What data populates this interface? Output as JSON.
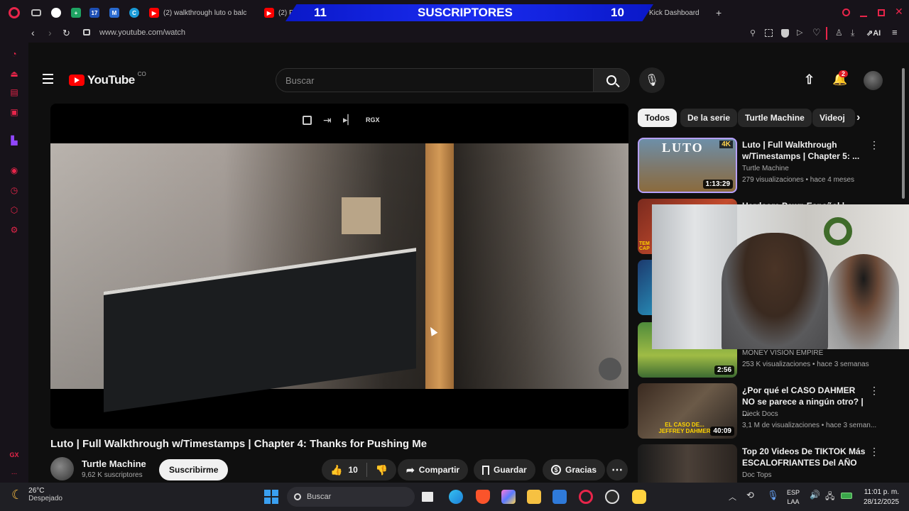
{
  "browser": {
    "tabs": [
      {
        "label": "(2) walkthrough luto o balc"
      },
      {
        "label": "(2) F"
      },
      {
        "label": "Kick Dashboard"
      }
    ],
    "new_tab": "+",
    "url": "www.youtube.com/watch",
    "ai_label": "AI"
  },
  "overlay": {
    "left_count": "11",
    "title": "SUSCRIPTORES",
    "right_count": "10"
  },
  "sidebar": {
    "gx_label": "GX",
    "more": "..."
  },
  "youtube": {
    "logo_text": "YouTube",
    "region": "CO",
    "search_placeholder": "Buscar",
    "notif_count": "2",
    "chips": [
      "Todos",
      "De la serie",
      "Turtle Machine",
      "Videoj"
    ],
    "player_buttons": {
      "rgx": "RGX"
    },
    "video": {
      "title": "Luto | Full Walkthrough w/Timestamps | Chapter 4: Thanks for Pushing Me",
      "channel": "Turtle Machine",
      "subscribers": "9,62 K suscriptores",
      "subscribe_label": "Suscribirme",
      "likes": "10",
      "share_label": "Compartir",
      "save_label": "Guardar",
      "thanks_label": "Gracias"
    },
    "recommendations": [
      {
        "title": "Luto | Full Walkthrough w/Timestamps | Chapter 5: ...",
        "channel": "Turtle Machine",
        "meta": "279 visualizaciones • hace 4 meses",
        "duration": "1:13:29",
        "badge": "4K",
        "thumb_text": "LUTO"
      },
      {
        "title": "Hardcore Pawn Español |",
        "channel": "",
        "meta": "",
        "duration": "",
        "thumb_text": "TEM CAP"
      },
      {
        "title": "",
        "channel": "",
        "meta": "",
        "duration": ""
      },
      {
        "title": "",
        "channel": "MONEY VISION EMPIRE",
        "meta": "253 K visualizaciones • hace 3 semanas",
        "duration": "2:56"
      },
      {
        "title": "¿Por qué el CASO DAHMER NO se parece a ningún otro? | ...",
        "channel": "Dieck Docs",
        "meta": "3,1 M de visualizaciones • hace 3 seman...",
        "duration": "40:09",
        "thumb_text": "EL CASO DE... JEFFREY DAHMER"
      },
      {
        "title": "Top 20 Videos De TIKTOK Más ESCALOFRIANTES Del AÑO",
        "channel": "Doc Tops",
        "meta": "",
        "duration": ""
      }
    ]
  },
  "taskbar": {
    "weather_temp": "26°C",
    "weather_desc": "Despejado",
    "search_placeholder": "Buscar",
    "lang1": "ESP",
    "lang2": "LAA",
    "time": "11:01 p. m.",
    "date": "28/12/2025"
  },
  "colors": {
    "accent_red": "#e8254a",
    "yt_red": "#ff0000",
    "banner_blue": "#1a2cf0"
  }
}
